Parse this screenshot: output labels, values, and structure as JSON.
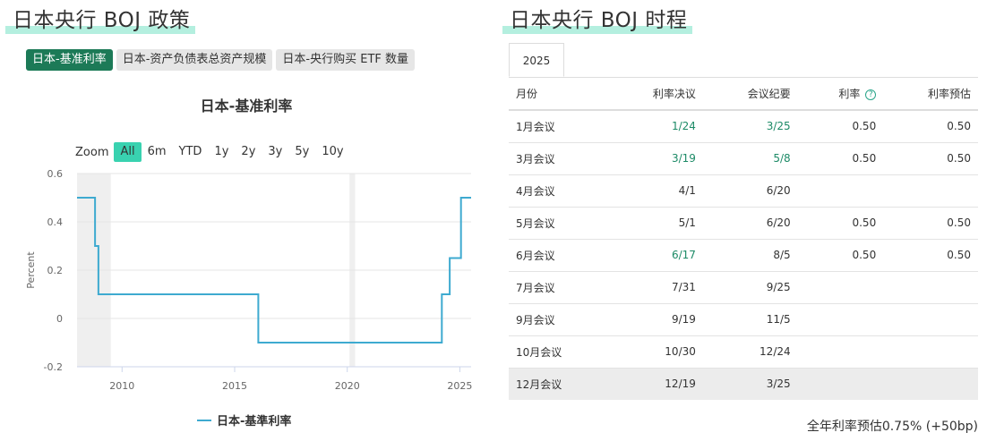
{
  "left": {
    "title": "日本央行 BOJ 政策",
    "tabs": [
      "日本-基准利率",
      "日本-资产负债表总资产规模",
      "日本-央行购买 ETF 数量"
    ],
    "active_tab": 0,
    "chart_title": "日本-基准利率",
    "zoom": {
      "label": "Zoom",
      "buttons": [
        "All",
        "6m",
        "YTD",
        "1y",
        "2y",
        "3y",
        "5y",
        "10y"
      ],
      "active": "All"
    }
  },
  "right": {
    "title": "日本央行 BOJ 时程",
    "year_tab": "2025",
    "columns": [
      "月份",
      "利率决议",
      "会议纪要",
      "利率",
      "利率预估"
    ],
    "rows": [
      {
        "month": "1月会议",
        "decision": "1/24",
        "minutes": "3/25",
        "rate": "0.50",
        "forecast": "0.50",
        "decision_link": true,
        "minutes_link": true
      },
      {
        "month": "3月会议",
        "decision": "3/19",
        "minutes": "5/8",
        "rate": "0.50",
        "forecast": "0.50",
        "decision_link": true,
        "minutes_link": true
      },
      {
        "month": "4月会议",
        "decision": "4/1",
        "minutes": "6/20",
        "rate": "",
        "forecast": "",
        "decision_link": false,
        "minutes_link": false
      },
      {
        "month": "5月会议",
        "decision": "5/1",
        "minutes": "6/20",
        "rate": "0.50",
        "forecast": "0.50",
        "decision_link": false,
        "minutes_link": false
      },
      {
        "month": "6月会议",
        "decision": "6/17",
        "minutes": "8/5",
        "rate": "0.50",
        "forecast": "0.50",
        "decision_link": true,
        "minutes_link": false
      },
      {
        "month": "7月会议",
        "decision": "7/31",
        "minutes": "9/25",
        "rate": "",
        "forecast": "",
        "decision_link": false,
        "minutes_link": false
      },
      {
        "month": "9月会议",
        "decision": "9/19",
        "minutes": "11/5",
        "rate": "",
        "forecast": "",
        "decision_link": false,
        "minutes_link": false
      },
      {
        "month": "10月会议",
        "decision": "10/30",
        "minutes": "12/24",
        "rate": "",
        "forecast": "",
        "decision_link": false,
        "minutes_link": false
      },
      {
        "month": "12月会议",
        "decision": "12/19",
        "minutes": "3/25",
        "rate": "",
        "forecast": "",
        "decision_link": false,
        "minutes_link": false
      }
    ],
    "footnote": "全年利率预估0.75% (+50bp)"
  },
  "colors": {
    "accent": "#1c7a57",
    "zoom_active": "#39d2b0",
    "line": "#3eaad0",
    "link": "#1c8a66",
    "highlight": "#b4efdf"
  },
  "chart_data": {
    "type": "line",
    "title": "日本-基准利率",
    "ylabel": "Percent",
    "ylim": [
      -0.2,
      0.6
    ],
    "xlim": [
      2008.0,
      2025.5
    ],
    "yticks": [
      "0.6",
      "0.4",
      "0.2",
      "0",
      "-0.2"
    ],
    "xticks": [
      "2010",
      "2015",
      "2020",
      "2025"
    ],
    "series": [
      {
        "name": "日本-基準利率",
        "x": [
          2008.0,
          2008.6,
          2008.8,
          2008.85,
          2008.95,
          2016.0,
          2016.05,
          2024.05,
          2024.2,
          2024.55,
          2024.95,
          2025.05,
          2025.5
        ],
        "y": [
          0.5,
          0.5,
          0.3,
          0.3,
          0.1,
          0.1,
          -0.1,
          -0.1,
          0.1,
          0.25,
          0.25,
          0.5,
          0.5
        ],
        "step": true
      }
    ],
    "shaded_periods": [
      [
        2008.0,
        2009.5
      ],
      [
        2020.1,
        2020.35
      ]
    ],
    "grid": true
  }
}
